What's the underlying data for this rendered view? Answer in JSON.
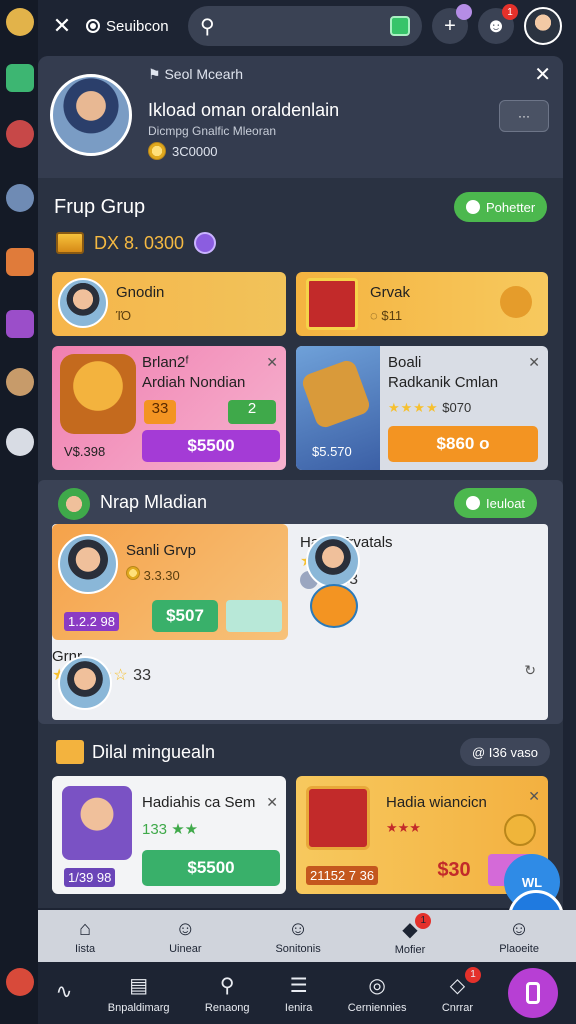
{
  "topbar": {
    "select_label": "Seuibcon",
    "search_placeholder": ""
  },
  "badges": {
    "add": "",
    "notif": "1"
  },
  "profile": {
    "tag": "Seol Mcearh",
    "name": "Ikload oman oraldenlain",
    "subtitle": "Dicmpg Gnalfic Mleoran",
    "coins": "3C0000",
    "button": "··· "
  },
  "group": {
    "title": "Frup Grup",
    "pill": "Pohetter",
    "stat": "DX 8. 0300",
    "row1": [
      {
        "title": "Gnodin",
        "sub": "ΊΌ"
      },
      {
        "title": "Grvak",
        "sub": "◌ $11"
      }
    ],
    "row2": [
      {
        "title": "Brlan2ᶠ",
        "title2": "Ardiah Nondian",
        "level": "33",
        "lvl2": "2",
        "price_small": "V$.398",
        "button": "$5500"
      },
      {
        "title": "Boali",
        "title2": "Radkanik Cmlan",
        "rating": "★★★★",
        "rating_value": "$070",
        "price_small": "$5.570",
        "button": "$860 o"
      }
    ]
  },
  "nearby": {
    "title": "Nrap Mladian",
    "pill": "Ieuloat",
    "items": [
      {
        "title": "Sanli Grvp",
        "coins": "3.3.30",
        "price_small": "1.2.2 98",
        "button": "$507"
      },
      {
        "title": "Haon Trvatals",
        "rating": "★★",
        "rating_value": "3",
        "extra": "3.1.3"
      },
      {
        "title": "Grnr",
        "rating": "★★☆☆☆",
        "rating_value": "33"
      }
    ]
  },
  "daily": {
    "title": "Dilal minguealn",
    "pill": "@ I36 vaso",
    "cards": [
      {
        "title": "Hadiahis ca Sem",
        "rating": "133 ★★",
        "price_small": "1/39 98",
        "button": "$5500"
      },
      {
        "title": "Hadia wiancicn",
        "rating": "★★★",
        "price_small": "21152 7 36",
        "button": "$30"
      }
    ]
  },
  "bottombar": [
    {
      "label": "Iista",
      "icon": "home-icon"
    },
    {
      "label": "Uinear",
      "icon": "user-icon"
    },
    {
      "label": "Sonitonis",
      "icon": "user-icon"
    },
    {
      "label": "Mofier",
      "icon": "chat-icon",
      "badge": "1"
    },
    {
      "label": "Plaoeite",
      "icon": "person-icon"
    }
  ],
  "navbar": [
    {
      "label": "",
      "icon": "wave-icon"
    },
    {
      "label": "Bnpaldimarg",
      "icon": "calendar-icon"
    },
    {
      "label": "Renaong",
      "icon": "search-icon"
    },
    {
      "label": "Ienira",
      "icon": "list-icon"
    },
    {
      "label": "Cerniennies",
      "icon": "compass-icon"
    },
    {
      "label": "Cnrrar",
      "icon": "chat-icon",
      "badge": "1"
    }
  ],
  "fab": {
    "label": "WL"
  },
  "colors": {
    "accent_green": "#4cb84e",
    "price_purple": "#a43bd6",
    "price_orange": "#f39422",
    "badge_red": "#e4312b"
  }
}
